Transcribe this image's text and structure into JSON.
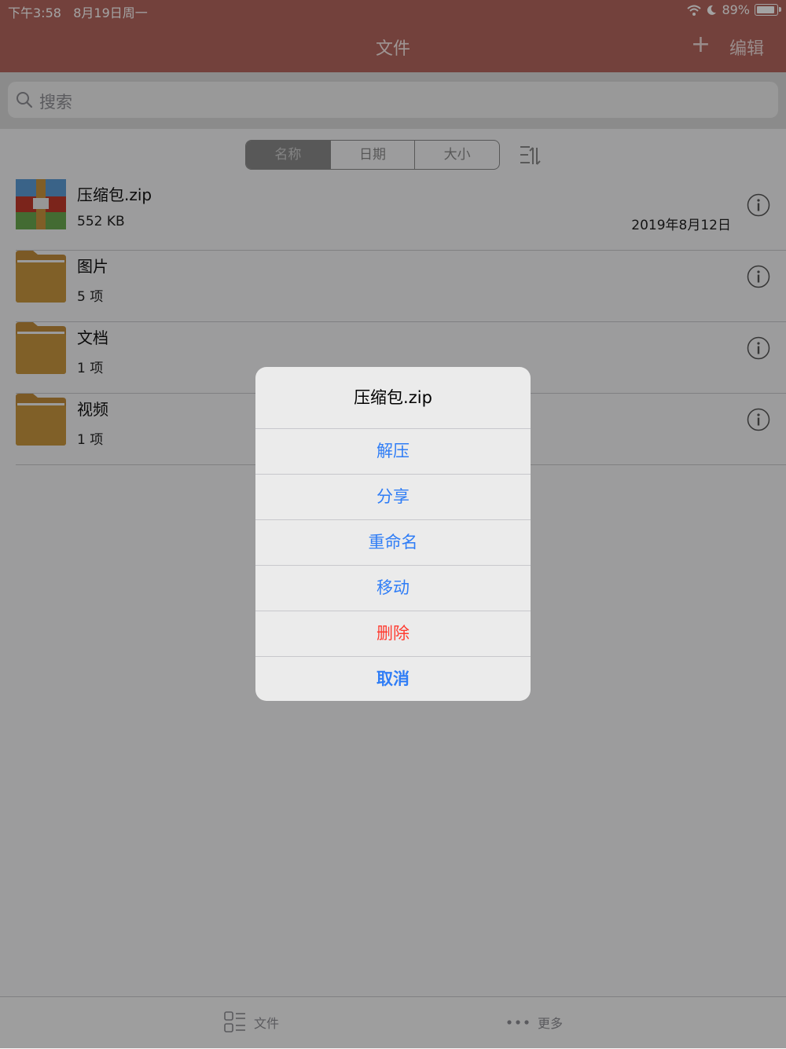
{
  "status": {
    "time": "下午3:58",
    "date": "8月19日周一",
    "battery": "89%"
  },
  "nav": {
    "title": "文件",
    "plus": "+",
    "edit": "编辑"
  },
  "search": {
    "placeholder": "搜索"
  },
  "segments": [
    "名称",
    "日期",
    "大小"
  ],
  "files": [
    {
      "name": "压缩包.zip",
      "sub": "552 KB",
      "date": "2019年8月12日",
      "kind": "zip"
    },
    {
      "name": "图片",
      "sub": "5 项",
      "date": "",
      "kind": "folder"
    },
    {
      "name": "文档",
      "sub": "1 项",
      "date": "",
      "kind": "folder"
    },
    {
      "name": "视频",
      "sub": "1 项",
      "date": "",
      "kind": "folder"
    }
  ],
  "sheet": {
    "title": "压缩包.zip",
    "actions": [
      "解压",
      "分享",
      "重命名",
      "移动",
      "删除"
    ],
    "cancel": "取消"
  },
  "tabs": {
    "files": "文件",
    "more": "更多"
  },
  "colors": {
    "nav": "#b5675f",
    "accent": "#2f7df6",
    "destructive": "#ff3b30",
    "folder": "#c08c3b"
  }
}
